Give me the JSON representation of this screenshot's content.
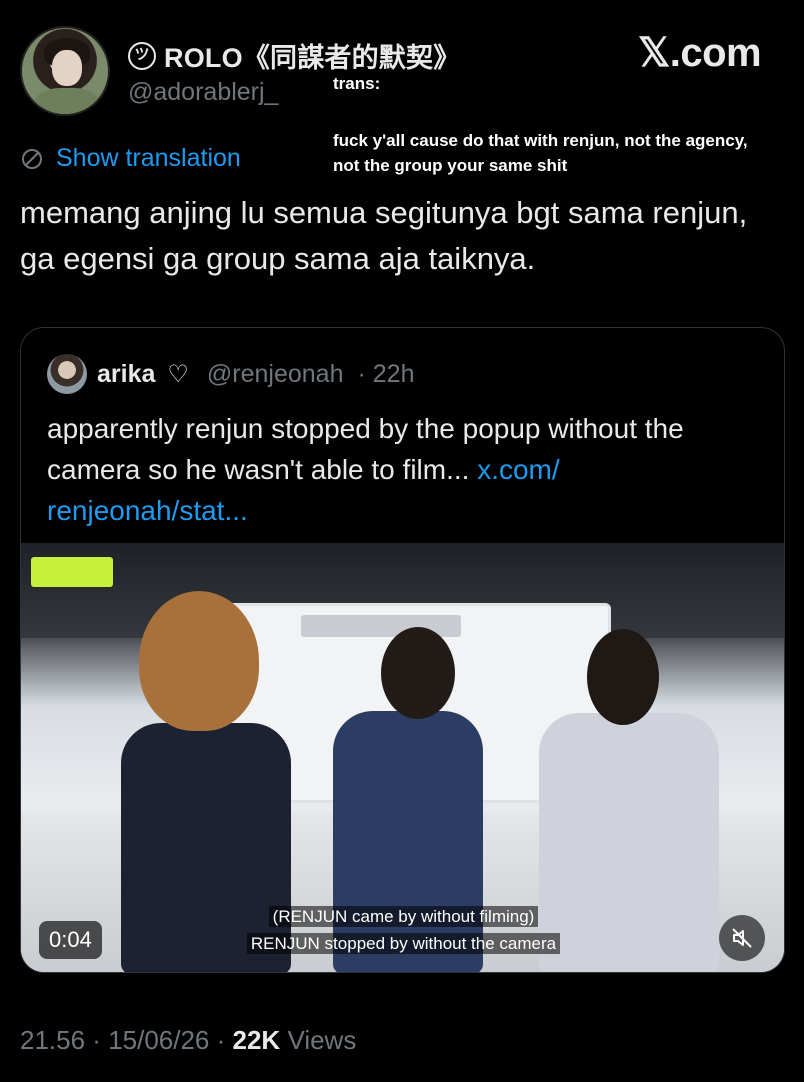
{
  "header": {
    "display_name": "ROLO《同謀者的默契》",
    "name_badge_glyph": "ツ",
    "handle": "@adorablerj_",
    "brand": "𝕏.com"
  },
  "overlay": {
    "trans_label": "trans:",
    "trans_text": "fuck y'all cause do that with renjun, not the agency, not the group your same shit"
  },
  "tweet": {
    "show_translation": "Show translation",
    "text": "memang anjing lu semua segitunya bgt sama renjun, ga egensi ga group sama aja taiknya."
  },
  "quote": {
    "name": "arika",
    "heart": "♡",
    "handle": "@renjeonah",
    "time": "· 22h",
    "text": "apparently renjun stopped by the popup without the camera so he wasn't able to film... ",
    "link": "x.com/ renjeonah/stat...",
    "video": {
      "subtitle_top": "(RENJUN came by without filming)",
      "subtitle_bottom": "RENJUN stopped by without the camera",
      "duration": "0:04"
    }
  },
  "meta": {
    "time": "21.56",
    "sep1": " · ",
    "date": "15/06/26",
    "sep2": " · ",
    "views_count": "22K",
    "views_label": " Views"
  },
  "colors": {
    "background": "#000000",
    "text": "#e7e9ea",
    "muted": "#71767b",
    "link": "#1d9bf0",
    "border": "#2f3336"
  }
}
